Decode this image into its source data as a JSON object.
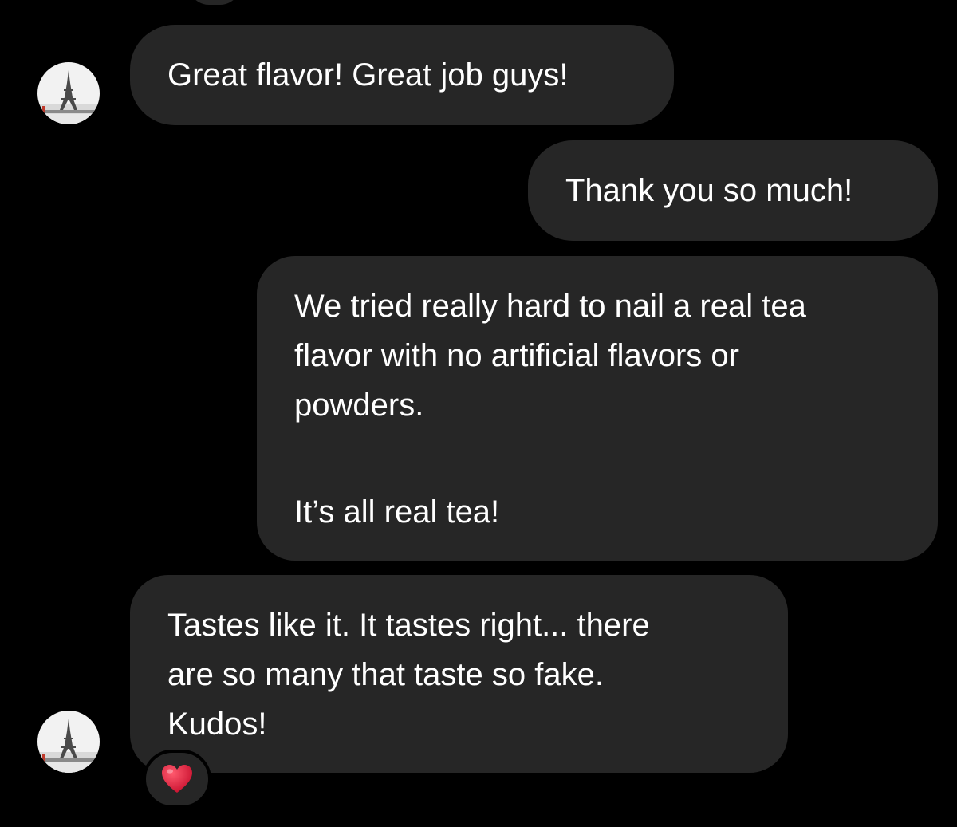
{
  "theme": {
    "background": "#000000",
    "bubble_color": "#262626",
    "text_color": "#ffffff",
    "reaction_color": "#e0213b"
  },
  "messages": [
    {
      "sender": "them",
      "lines": [
        "Great flavor! Great job guys!"
      ],
      "avatar": "eiffel-tower-avatar"
    },
    {
      "sender": "me",
      "lines": [
        "Thank you so much!"
      ]
    },
    {
      "sender": "me",
      "lines": [
        "We tried really hard to nail a real tea",
        "flavor with no artificial flavors or",
        "powders.",
        "It’s all real tea!"
      ]
    },
    {
      "sender": "them",
      "lines": [
        "Tastes like it. It tastes right... there",
        "are so many that taste so fake.",
        "Kudos!"
      ],
      "avatar": "eiffel-tower-avatar",
      "reaction": "heart-icon"
    }
  ]
}
